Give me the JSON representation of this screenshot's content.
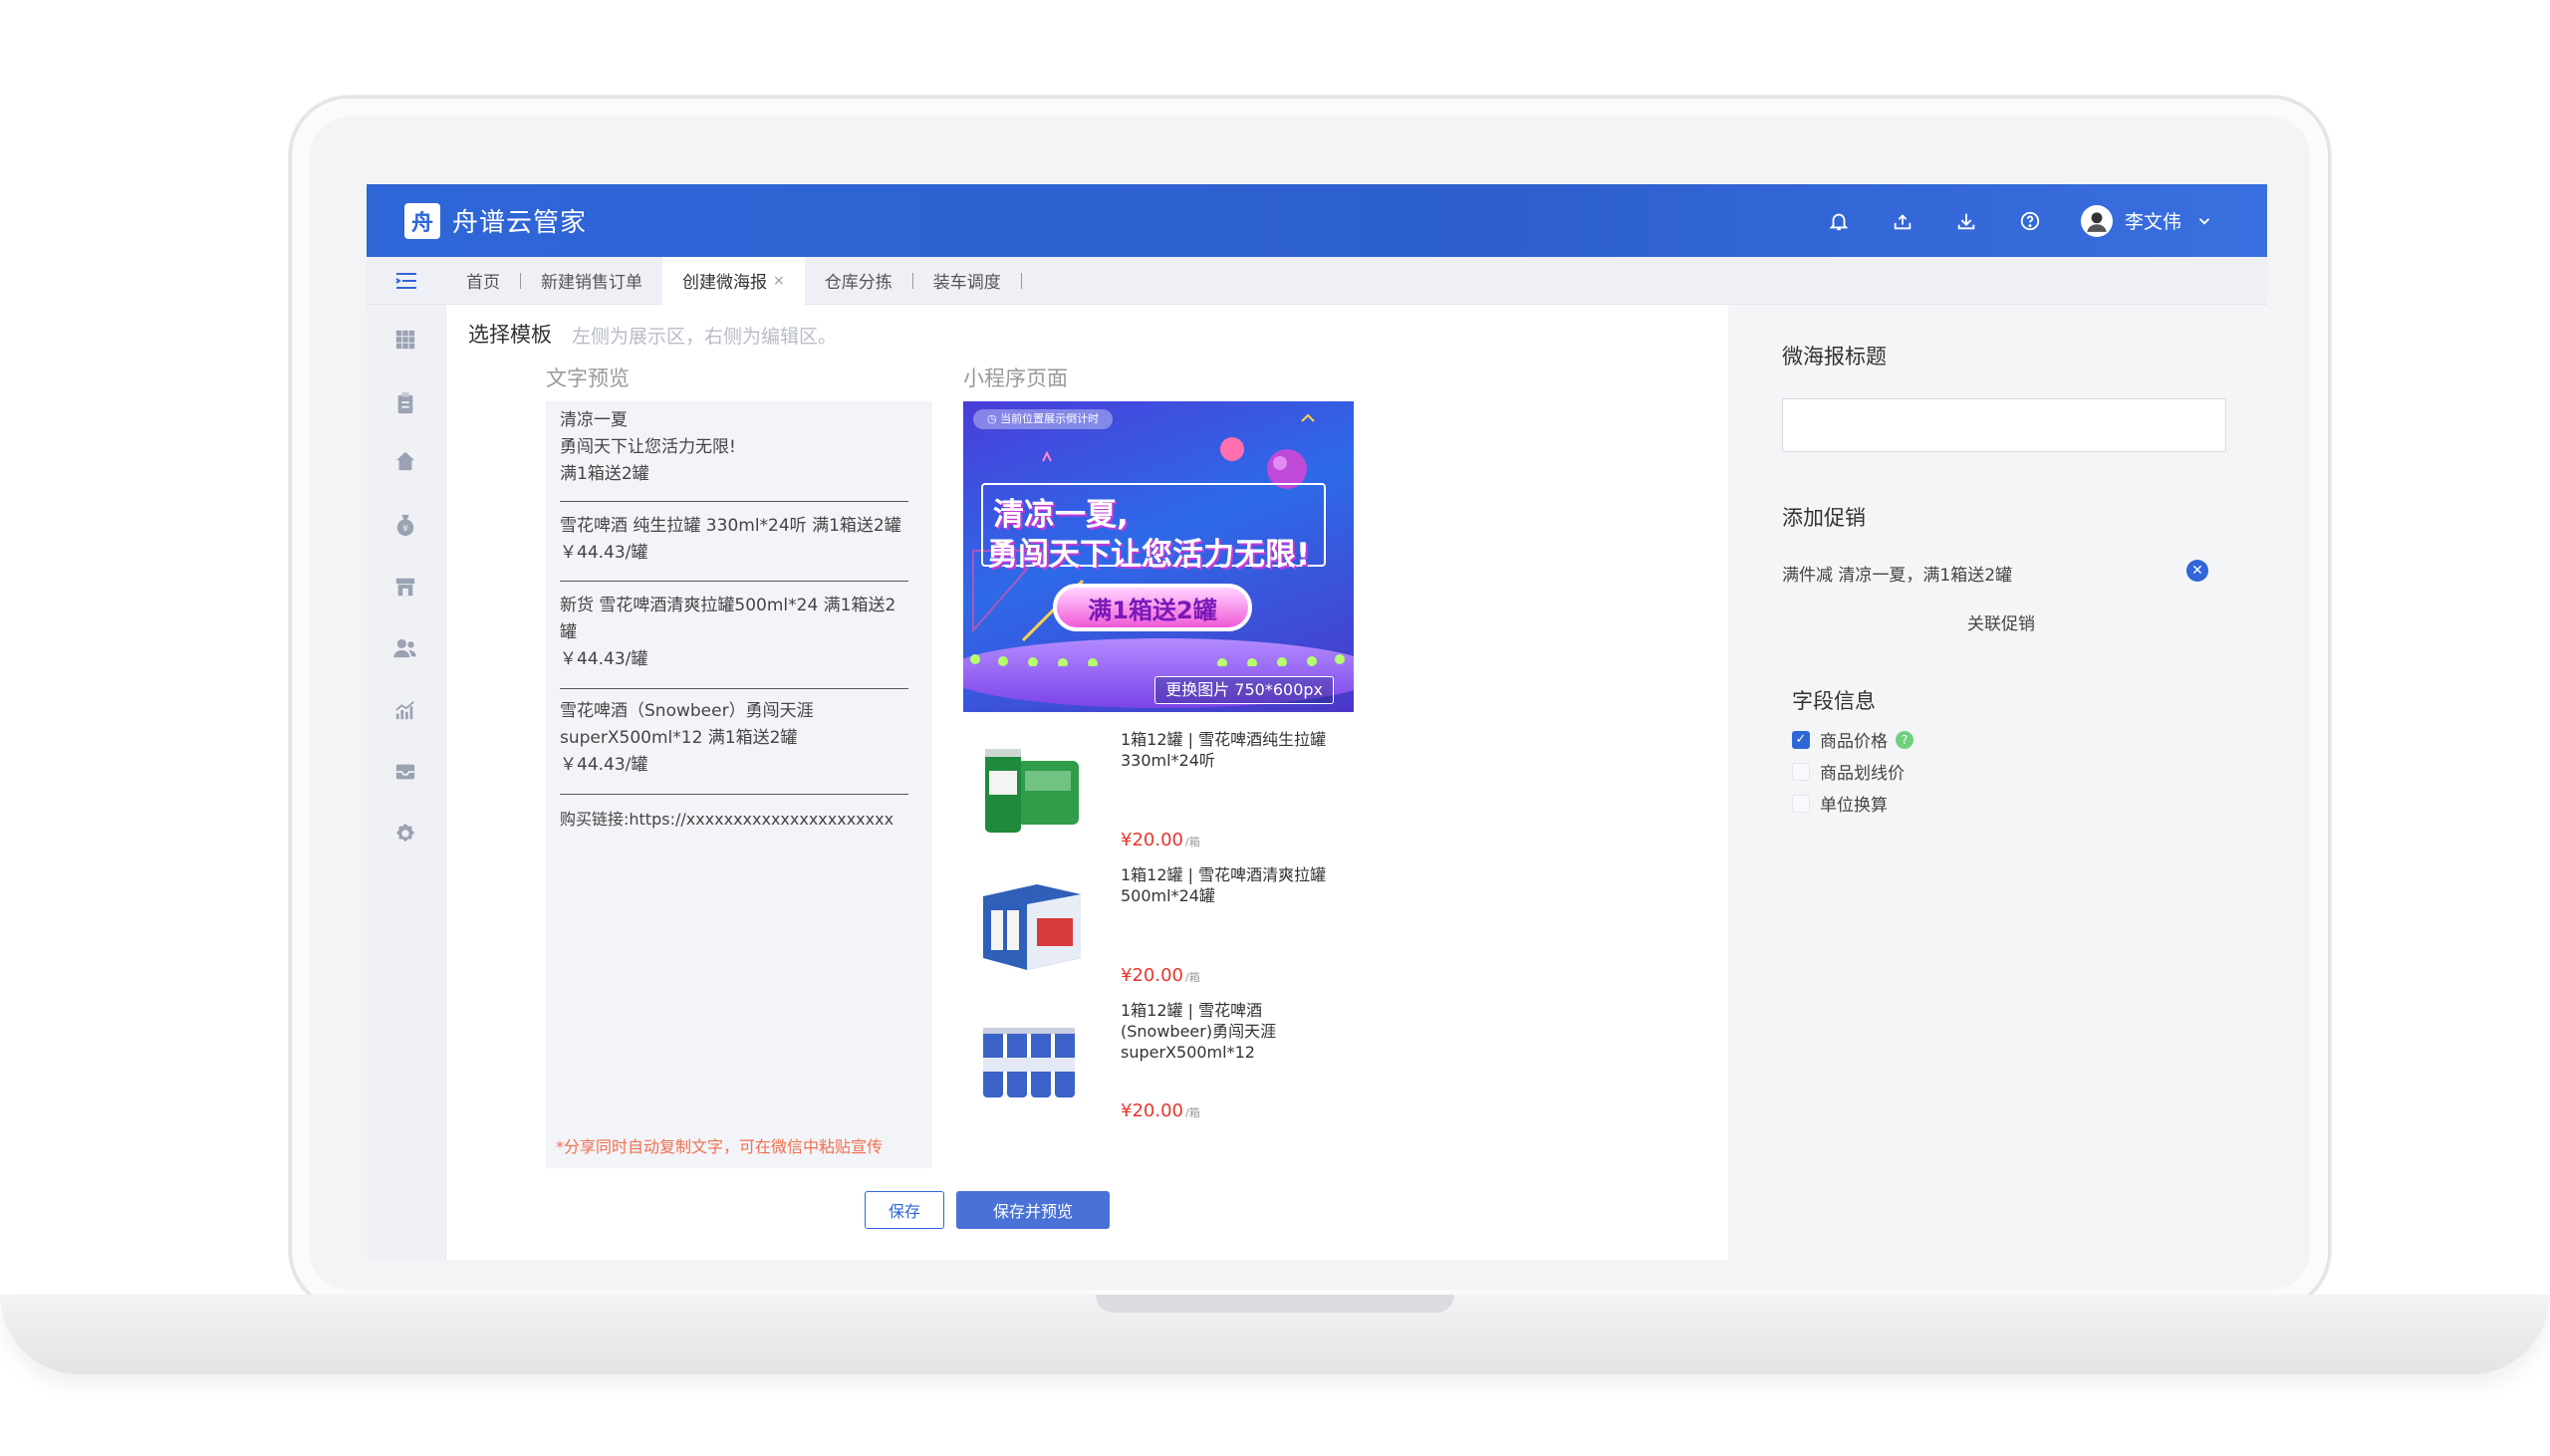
{
  "header": {
    "logo_glyph": "舟",
    "app_title": "舟谱云管家",
    "user_name": "李文伟",
    "icons": [
      "bell-icon",
      "share-icon",
      "download-icon",
      "help-icon",
      "chevron-down-icon"
    ],
    "accent": "#2f66d8"
  },
  "tabs": [
    {
      "label": "首页",
      "active": false
    },
    {
      "label": "新建销售订单",
      "active": false
    },
    {
      "label": "创建微海报",
      "active": true,
      "close": "×"
    },
    {
      "label": "仓库分拣",
      "active": false
    },
    {
      "label": "装车调度",
      "active": false
    }
  ],
  "sidebar": {
    "icons": [
      "grid-icon",
      "clipboard-icon",
      "home-icon",
      "money-bag-icon",
      "store-icon",
      "users-icon",
      "chart-icon",
      "mail-icon",
      "settings-icon"
    ]
  },
  "main": {
    "title": "选择模板",
    "hint": "左侧为展示区，右侧为编辑区。",
    "text_preview_label": "文字预览",
    "mini_program_label": "小程序页面",
    "text_preview": {
      "intro": [
        "清凉一夏",
        "勇闯天下让您活力无限!",
        "满1箱送2罐"
      ],
      "items": [
        [
          "雪花啤酒 纯生拉罐 330ml*24听 满1箱送2罐",
          "￥44.43/罐"
        ],
        [
          "新货 雪花啤酒清爽拉罐500ml*24 满1箱送2",
          "罐",
          "￥44.43/罐"
        ],
        [
          "雪花啤酒（Snowbeer）勇闯天涯",
          "superX500ml*12 满1箱送2罐",
          "￥44.43/罐"
        ]
      ],
      "link": "购买链接:https://xxxxxxxxxxxxxxxxxxxxxx",
      "note": "*分享同时自动复制文字，可在微信中粘贴宣传"
    },
    "poster": {
      "countdown": "当前位置展示倒计时",
      "line1": "清凉一夏,",
      "line2": "勇闯天下让您活力无限!",
      "button": "满1箱送2罐",
      "change": "更换图片 750*600px"
    },
    "products": [
      {
        "name": "1箱12罐 | 雪花啤酒纯生拉罐330ml*24听",
        "price": "¥20.00",
        "unit": "/箱"
      },
      {
        "name": "1箱12罐 | 雪花啤酒清爽拉罐500ml*24罐",
        "price": "¥20.00",
        "unit": "/箱"
      },
      {
        "name": "1箱12罐 | 雪花啤酒(Snowbeer)勇闯天涯superX500ml*12",
        "price": "¥20.00",
        "unit": "/箱"
      }
    ],
    "save_label": "保存",
    "save_preview_label": "保存并预览"
  },
  "right": {
    "poster_title_label": "微海报标题",
    "poster_title_value": "",
    "promo_label": "添加促销",
    "promo_text": "满件减 清凉一夏，满1箱送2罐",
    "promo_link": "关联促销",
    "fields_label": "字段信息",
    "fields": [
      {
        "label": "商品价格",
        "checked": true,
        "help": "?"
      },
      {
        "label": "商品划线价",
        "checked": false
      },
      {
        "label": "单位换算",
        "checked": false
      }
    ]
  }
}
